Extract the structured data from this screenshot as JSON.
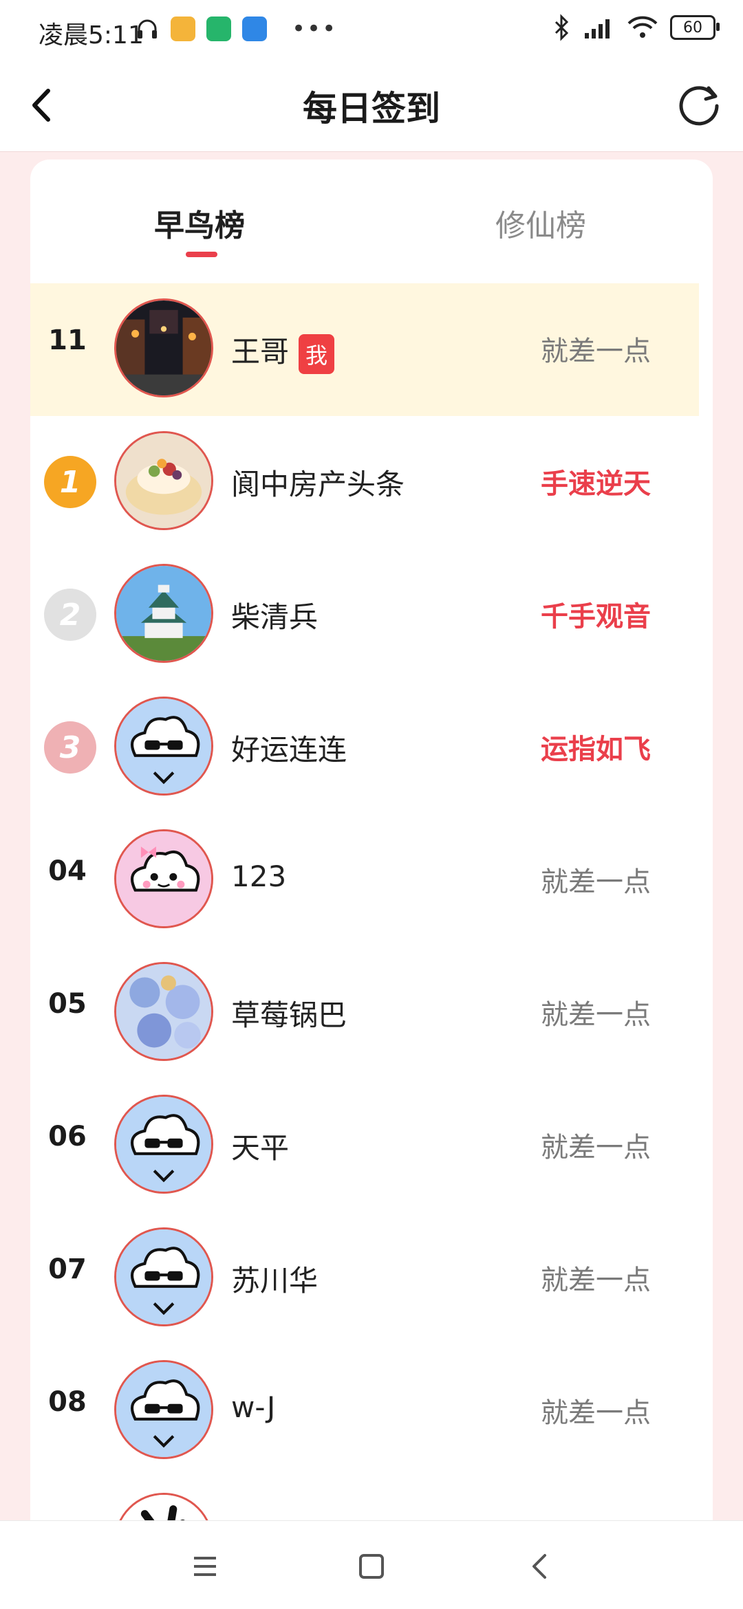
{
  "status_bar": {
    "time": "凌晨5:11",
    "battery": "60"
  },
  "header": {
    "title": "每日签到"
  },
  "tabs": [
    {
      "label": "早鸟榜",
      "active": true
    },
    {
      "label": "修仙榜",
      "active": false
    }
  ],
  "me_badge": "我",
  "rows": [
    {
      "rank": "11",
      "name": "王哥",
      "status": "就差一点",
      "highlight": true,
      "status_red": false,
      "avatar": "night-street-photo"
    },
    {
      "rank": "1",
      "name": "阆中房产头条",
      "status": "手速逆天",
      "medal": "gold",
      "status_red": true,
      "avatar": "dessert-photo"
    },
    {
      "rank": "2",
      "name": "柴清兵",
      "status": "千手观音",
      "medal": "silver",
      "status_red": true,
      "avatar": "castle-photo"
    },
    {
      "rank": "3",
      "name": "好运连连",
      "status": "运指如飞",
      "medal": "bronze",
      "status_red": true,
      "avatar": "cloud-sunglasses"
    },
    {
      "rank": "04",
      "name": "123",
      "status": "就差一点",
      "status_red": false,
      "avatar": "cloud-bow"
    },
    {
      "rank": "05",
      "name": "草莓锅巴",
      "status": "就差一点",
      "status_red": false,
      "avatar": "flowers-photo"
    },
    {
      "rank": "06",
      "name": "天平",
      "status": "就差一点",
      "status_red": false,
      "avatar": "cloud-sunglasses"
    },
    {
      "rank": "07",
      "name": "苏川华",
      "status": "就差一点",
      "status_red": false,
      "avatar": "cloud-sunglasses"
    },
    {
      "rank": "08",
      "name": "w-J",
      "status": "就差一点",
      "status_red": false,
      "avatar": "cloud-sunglasses"
    }
  ],
  "colors": {
    "accent_red": "#ea3f4b",
    "highlight_row": "#fff7df",
    "page_bg": "#fdecec"
  }
}
